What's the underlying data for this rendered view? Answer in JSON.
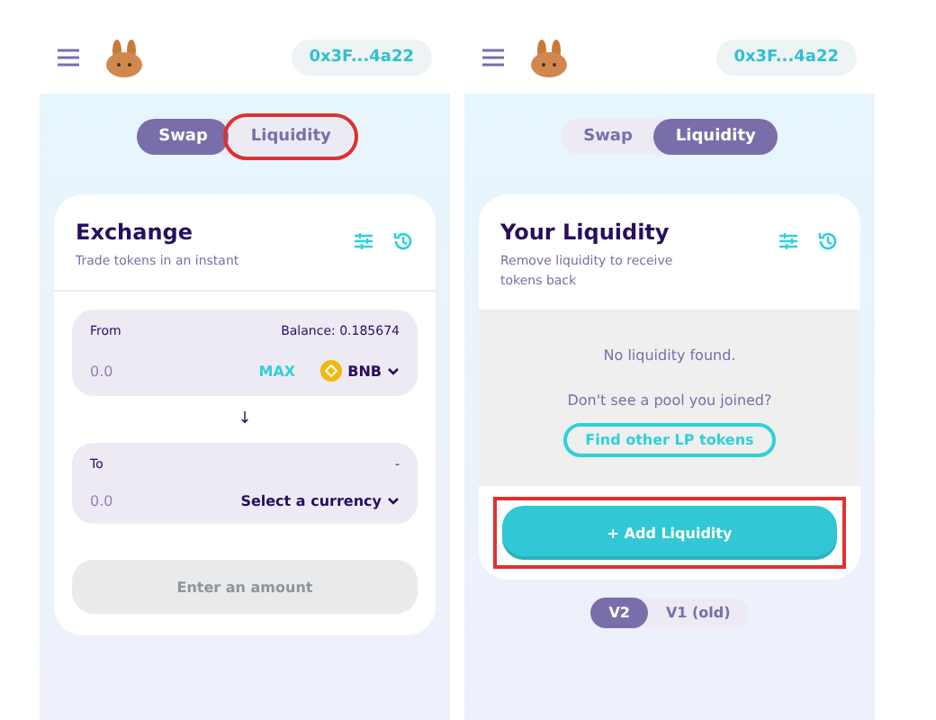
{
  "screens": [
    {
      "header": {
        "address": "0x3F...4a22"
      },
      "tabs": [
        {
          "label": "Swap",
          "selected": true,
          "highlighted": false
        },
        {
          "label": "Liquidity",
          "selected": false,
          "highlighted": true
        }
      ],
      "card": {
        "kind": "exchange",
        "title": "Exchange",
        "subtitle": "Trade tokens in an instant",
        "from": {
          "label": "From",
          "balance": "Balance: 0.185674",
          "amount": "0.0",
          "max": "MAX",
          "token": "BNB"
        },
        "arrow": "↓",
        "to": {
          "label": "To",
          "reading": "-",
          "amount": "0.0",
          "token": "Select a currency"
        },
        "button": {
          "label": "Enter an amount",
          "disabled": true
        }
      }
    },
    {
      "header": {
        "address": "0x3F...4a22"
      },
      "tabs": [
        {
          "label": "Swap",
          "selected": false,
          "highlighted": false
        },
        {
          "label": "Liquidity",
          "selected": true,
          "highlighted": false
        }
      ],
      "card": {
        "kind": "liquidity",
        "title": "Your Liquidity",
        "subtitle": "Remove liquidity to receive tokens back",
        "empty": "No liquidity found.",
        "question": "Don't see a pool you joined?",
        "find": "Find other LP tokens",
        "button": {
          "label": "+ Add Liquidity",
          "disabled": false,
          "highlighted": true
        }
      },
      "versions": [
        {
          "label": "V2",
          "selected": true
        },
        {
          "label": "V1 (old)",
          "selected": false
        }
      ]
    }
  ]
}
